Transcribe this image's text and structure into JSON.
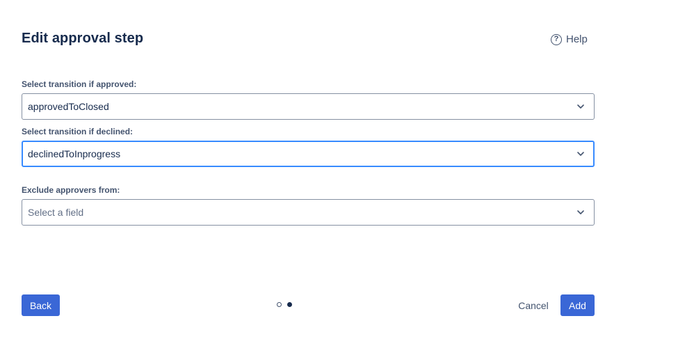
{
  "dialog": {
    "title": "Edit approval step",
    "help_label": "Help"
  },
  "fields": {
    "approved": {
      "label": "Select transition if approved:",
      "value": "approvedToClosed"
    },
    "declined": {
      "label": "Select transition if declined:",
      "value": "declinedToInprogress"
    },
    "exclude": {
      "label": "Exclude approvers from:",
      "placeholder": "Select a field"
    }
  },
  "footer": {
    "back_label": "Back",
    "cancel_label": "Cancel",
    "add_label": "Add",
    "pagination": {
      "current_page": 2,
      "total_pages": 2
    }
  },
  "colors": {
    "primary": "#3a67d6",
    "focus_border": "#388bff",
    "text": "#172b4d"
  }
}
